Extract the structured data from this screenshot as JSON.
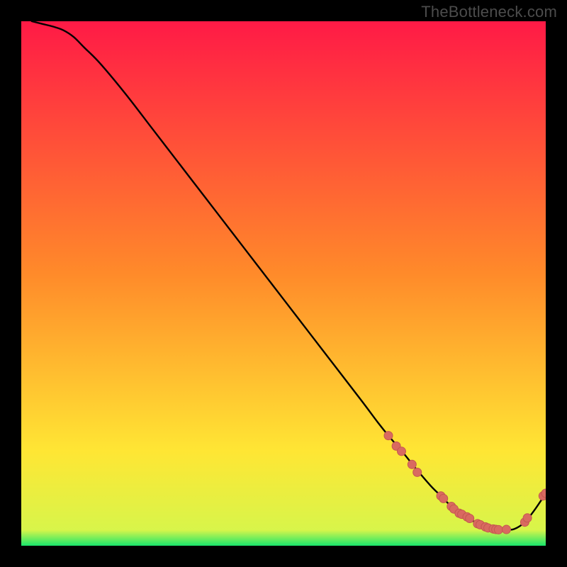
{
  "watermark": "TheBottleneck.com",
  "colors": {
    "bg_black": "#000000",
    "grad_top": "#ff1a46",
    "grad_upper_mid": "#ff8a2a",
    "grad_lower_mid": "#ffe634",
    "grad_bottom_green": "#19e66b",
    "curve": "#000000",
    "marker_fill": "#d96a60",
    "marker_stroke": "#c4584f",
    "watermark_text": "#4c4c4c"
  },
  "chart_data": {
    "type": "line",
    "title": "",
    "xlabel": "",
    "ylabel": "",
    "xlim": [
      0,
      100
    ],
    "ylim": [
      0,
      100
    ],
    "curve": {
      "x": [
        2,
        4,
        6,
        8,
        10,
        12,
        15,
        20,
        25,
        30,
        35,
        40,
        45,
        50,
        55,
        60,
        65,
        68,
        70,
        73,
        75,
        78,
        80,
        82,
        84,
        86,
        88,
        90,
        92,
        94,
        96,
        98,
        100
      ],
      "y": [
        100,
        99.5,
        99,
        98.3,
        97,
        95,
        92,
        86,
        79.5,
        73,
        66.5,
        60,
        53.5,
        47,
        40.5,
        34,
        27.5,
        23.5,
        21,
        17.5,
        15,
        11.5,
        9.5,
        7.5,
        6,
        4.8,
        3.8,
        3.2,
        3,
        3.2,
        4.5,
        7,
        10
      ]
    },
    "markers": [
      {
        "x": 70.0,
        "y": 21.0
      },
      {
        "x": 71.5,
        "y": 19.0
      },
      {
        "x": 72.5,
        "y": 18.0
      },
      {
        "x": 74.5,
        "y": 15.5
      },
      {
        "x": 75.5,
        "y": 14.0
      },
      {
        "x": 80.0,
        "y": 9.5
      },
      {
        "x": 80.5,
        "y": 9.0
      },
      {
        "x": 82.0,
        "y": 7.5
      },
      {
        "x": 82.5,
        "y": 7.0
      },
      {
        "x": 83.5,
        "y": 6.2
      },
      {
        "x": 84.0,
        "y": 6.0
      },
      {
        "x": 85.0,
        "y": 5.5
      },
      {
        "x": 85.5,
        "y": 5.2
      },
      {
        "x": 87.0,
        "y": 4.2
      },
      {
        "x": 87.5,
        "y": 4.0
      },
      {
        "x": 88.5,
        "y": 3.6
      },
      {
        "x": 89.0,
        "y": 3.4
      },
      {
        "x": 90.0,
        "y": 3.2
      },
      {
        "x": 90.5,
        "y": 3.1
      },
      {
        "x": 91.0,
        "y": 3.05
      },
      {
        "x": 92.5,
        "y": 3.1
      },
      {
        "x": 96.0,
        "y": 4.5
      },
      {
        "x": 96.5,
        "y": 5.3
      },
      {
        "x": 99.5,
        "y": 9.5
      },
      {
        "x": 100.0,
        "y": 10.0
      }
    ]
  }
}
